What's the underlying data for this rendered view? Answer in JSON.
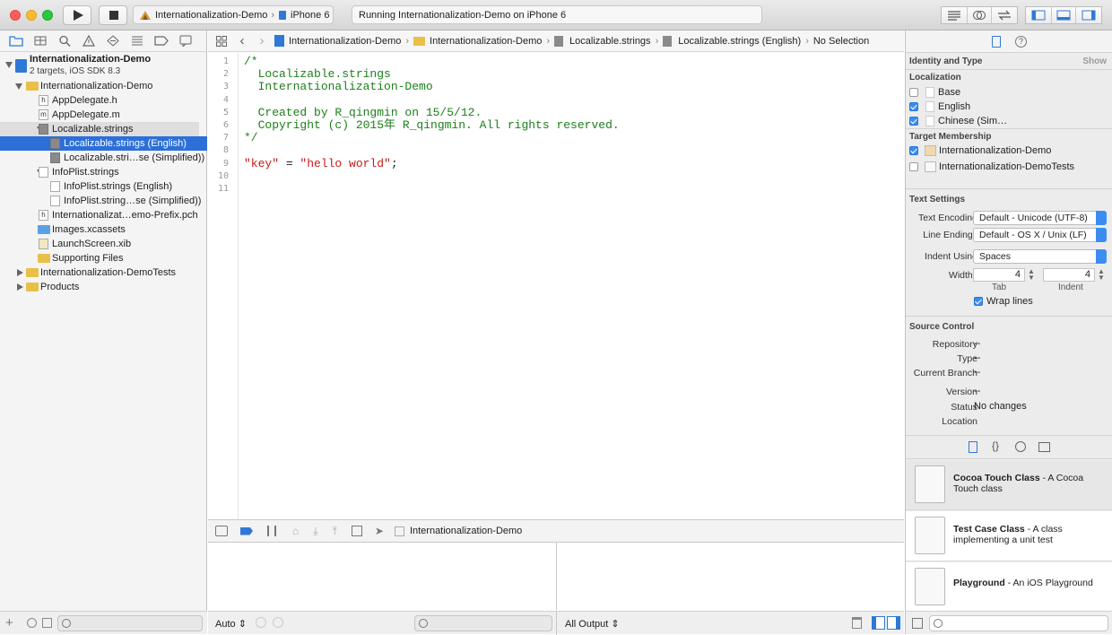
{
  "toolbar": {
    "scheme": "Internationalization-Demo",
    "device": "iPhone 6",
    "activity": "Running Internationalization-Demo on iPhone 6"
  },
  "navigator": {
    "project": {
      "name": "Internationalization-Demo",
      "subtitle": "2 targets, iOS SDK 8.3"
    },
    "items": [
      {
        "label": "Internationalization-Demo",
        "kind": "folder",
        "indent": 1,
        "disclosure": "open"
      },
      {
        "label": "AppDelegate.h",
        "kind": "h",
        "indent": 2
      },
      {
        "label": "AppDelegate.m",
        "kind": "m",
        "indent": 2
      },
      {
        "label": "Localizable.strings",
        "kind": "strings",
        "indent": 2,
        "disclosure": "open",
        "state": "highlight"
      },
      {
        "label": "Localizable.strings (English)",
        "kind": "strings",
        "indent": 3,
        "state": "selected"
      },
      {
        "label": "Localizable.stri…se (Simplified))",
        "kind": "strings",
        "indent": 3
      },
      {
        "label": "InfoPlist.strings",
        "kind": "file",
        "indent": 2,
        "disclosure": "open"
      },
      {
        "label": "InfoPlist.strings (English)",
        "kind": "file",
        "indent": 3
      },
      {
        "label": "InfoPlist.string…se (Simplified))",
        "kind": "file",
        "indent": 3
      },
      {
        "label": "Internationalizat…emo-Prefix.pch",
        "kind": "h",
        "indent": 2
      },
      {
        "label": "Images.xcassets",
        "kind": "assets",
        "indent": 2
      },
      {
        "label": "LaunchScreen.xib",
        "kind": "xib",
        "indent": 2,
        "disclosure": "closed"
      },
      {
        "label": "Supporting Files",
        "kind": "folder",
        "indent": 2,
        "disclosure": "closed"
      },
      {
        "label": "Internationalization-DemoTests",
        "kind": "folder",
        "indent": 1,
        "disclosure": "closed"
      },
      {
        "label": "Products",
        "kind": "folder",
        "indent": 1,
        "disclosure": "closed"
      }
    ]
  },
  "jumpbar": [
    "Internationalization-Demo",
    "Internationalization-Demo",
    "Localizable.strings",
    "Localizable.strings (English)",
    "No Selection"
  ],
  "editor": {
    "lines": [
      {
        "n": "1",
        "text": "/*",
        "cls": "cm"
      },
      {
        "n": "2",
        "text": "  Localizable.strings",
        "cls": "cm"
      },
      {
        "n": "3",
        "text": "  Internationalization-Demo",
        "cls": "cm"
      },
      {
        "n": "4",
        "text": "",
        "cls": "cm"
      },
      {
        "n": "5",
        "text": "  Created by R_qingmin on 15/5/12.",
        "cls": "cm"
      },
      {
        "n": "6",
        "text": "  Copyright (c) 2015年 R_qingmin. All rights reserved.",
        "cls": "cm"
      },
      {
        "n": "7",
        "text": "*/",
        "cls": "cm"
      },
      {
        "n": "8",
        "text": "",
        "cls": ""
      },
      {
        "n": "9",
        "key": "\"key\"",
        "eq": " = ",
        "value": "\"hello world\"",
        "semi": ";"
      },
      {
        "n": "10",
        "text": "",
        "cls": ""
      },
      {
        "n": "11",
        "text": "",
        "cls": ""
      }
    ]
  },
  "debug": {
    "target": "Internationalization-Demo",
    "auto_label": "Auto",
    "output_label": "All Output"
  },
  "inspector": {
    "identity_header": "Identity and Type",
    "show_label": "Show",
    "localization_header": "Localization",
    "localizations": [
      {
        "label": "Base",
        "checked": false
      },
      {
        "label": "English",
        "checked": true
      },
      {
        "label": "Chinese (Sim…",
        "checked": true
      }
    ],
    "membership_header": "Target Membership",
    "targets": [
      {
        "label": "Internationalization-Demo",
        "checked": true
      },
      {
        "label": "Internationalization-DemoTests",
        "checked": false
      }
    ],
    "text_settings_header": "Text Settings",
    "text_encoding_label": "Text Encoding",
    "text_encoding": "Default - Unicode (UTF-8)",
    "line_endings_label": "Line Endings",
    "line_endings": "Default - OS X / Unix (LF)",
    "indent_using_label": "Indent Using",
    "indent_using": "Spaces",
    "widths_label": "Widths",
    "tab_width": "4",
    "indent_width": "4",
    "tab_label": "Tab",
    "indent_label": "Indent",
    "wrap_lines": "Wrap lines",
    "source_control_header": "Source Control",
    "sc": [
      {
        "label": "Repository",
        "value": "--"
      },
      {
        "label": "Type",
        "value": "--"
      },
      {
        "label": "Current Branch",
        "value": "--"
      },
      {
        "label": "Version",
        "value": "--"
      },
      {
        "label": "Status",
        "value": "No changes"
      },
      {
        "label": "Location",
        "value": ""
      }
    ],
    "library": [
      {
        "title": "Cocoa Touch Class",
        "desc": " - A Cocoa Touch class"
      },
      {
        "title": "Test Case Class",
        "desc": " - A class implementing a unit test"
      },
      {
        "title": "Playground",
        "desc": " - An iOS Playground"
      }
    ]
  },
  "colors": {
    "selection": "#2c6fd9",
    "comment": "#1b7f1b",
    "string": "#c41a16",
    "accent": "#3b8ef0"
  }
}
